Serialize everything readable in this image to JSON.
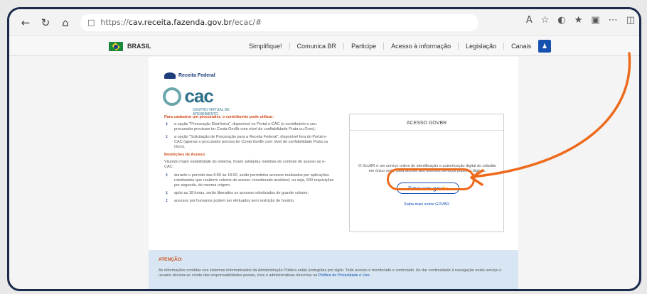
{
  "browser": {
    "url_prefix": "https://",
    "url_host": "cav.receita.fazenda.gov.br",
    "url_path": "/ecac/#",
    "icons": [
      "back-arrow-icon",
      "refresh-icon",
      "home-icon",
      "lock-icon",
      "read-aloud-icon",
      "favorite-icon",
      "extensions-icon",
      "favorites-list-icon",
      "collections-icon",
      "more-icon",
      "sidebar-icon"
    ]
  },
  "gov_bar": {
    "brasil": "BRASIL",
    "links": [
      "Simplifique!",
      "Comunica BR",
      "Participe",
      "Acesso à informação",
      "Legislação",
      "Canais"
    ]
  },
  "brand": {
    "receita_label": "Receita Federal",
    "ecac_word": "cac",
    "ecac_sub": "CENTRO VIRTUAL DE ATENDIMENTO"
  },
  "left": {
    "heading1": "Para cadastrar um procurador, o contribuinte pode utilizar:",
    "items1": [
      "a opção \"Procuração Eletrônica\", disponível no Portal e-CAC (o contribuinte e seu procurador precisam ter Conta GovBr com nível de confiabilidade Prata ou Ouro);",
      "a opção \"Solicitação de Procuração para a Receita Federal\", disponível fora do Portal e-CAC (apenas o procurador precisa ter Conta GovBr com nível de confiabilidade Prata ou Ouro)."
    ],
    "heading2": "Restrições de Acesso",
    "para": "Visando maior estabilidade do sistema, foram adotadas medidas de controle de acesso ao e-CAC:",
    "items2": [
      "durante o período das 6:00 às 18:00, serão permitidos acessos realizados por aplicações robotizadas que realizem volume de acesso considerado aceitável, ou seja, 500 requisições por segundo, de mesma origem;",
      "após as 18 horas, serão liberados os acessos robotizados de grande volume;",
      "acessos por humanos podem ser efetuados sem restrição de horário."
    ]
  },
  "govbr": {
    "title": "ACESSO GOVBR",
    "description": "O GovBR é um serviço online de identificação e autenticação digital do cidadão em único meio, para acesso aos diversos serviços públicos digitais.",
    "button_text": "Entrar com",
    "button_brand_a": "gov",
    "button_brand_b": "br",
    "link": "Saiba mais sobre GOVBR"
  },
  "attention": {
    "title": "ATENÇÃO:",
    "text": "As informações contidas nos sistemas informatizados da Administração Pública estão protegidas por sigilo. Todo acesso é monitorado e controlado. Ao dar continuidade à navegação neste serviço o usuário declara-se ciente das responsabilidades penais, civis e administrativas descritas na",
    "link": "Política de Privacidade e Uso."
  },
  "colors": {
    "highlight": "#ee6a1b",
    "govbr_blue": "#1351b4",
    "heading_orange": "#d04a1a"
  }
}
